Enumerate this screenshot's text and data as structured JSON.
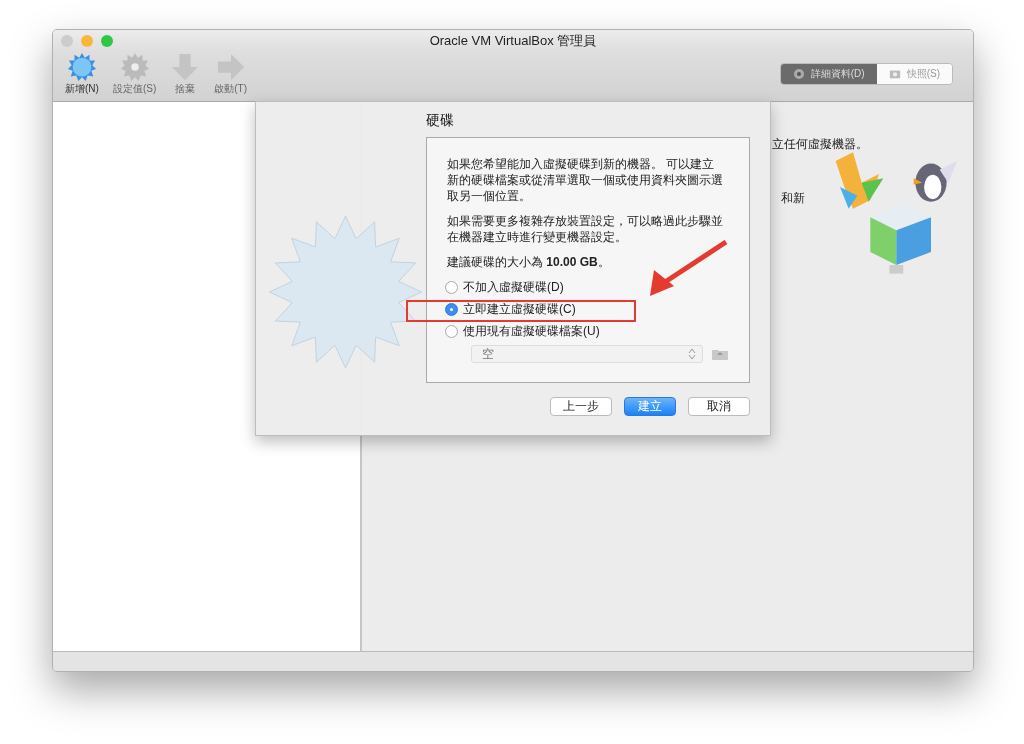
{
  "window": {
    "title": "Oracle VM VirtualBox 管理員"
  },
  "toolbar": [
    {
      "label": "新增(N)",
      "kind": "new",
      "disabled": false
    },
    {
      "label": "設定值(S)",
      "kind": "settings",
      "disabled": true
    },
    {
      "label": "捨棄",
      "kind": "discard",
      "disabled": true
    },
    {
      "label": "啟動(T)",
      "kind": "start",
      "disabled": true
    }
  ],
  "view_tabs": [
    {
      "label": "詳細資料(D)",
      "kind": "details",
      "selected": true
    },
    {
      "label": "快照(S)",
      "kind": "snapshots",
      "selected": false
    }
  ],
  "welcome": {
    "line_1_tail": "立任何虛擬機器。",
    "line_3_tail": "和新"
  },
  "dialog": {
    "title": "硬碟",
    "paragraphs": [
      "如果您希望能加入虛擬硬碟到新的機器。 可以建立新的硬碟檔案或從清單選取一個或使用資料夾圖示選取另一個位置。",
      "如果需要更多複雜存放裝置設定，可以略過此步驟並在機器建立時進行變更機器設定。",
      "建議硬碟的大小為 **10.00 GB**。"
    ],
    "options": [
      {
        "label": "不加入虛擬硬碟(D)",
        "selected": false
      },
      {
        "label": "立即建立虛擬硬碟(C)",
        "selected": true
      },
      {
        "label": "使用現有虛擬硬碟檔案(U)",
        "selected": false
      }
    ],
    "file_select": {
      "value": "空",
      "disabled": true
    },
    "buttons": [
      {
        "label": "上一步",
        "kind": "secondary"
      },
      {
        "label": "建立",
        "kind": "default"
      },
      {
        "label": "取消",
        "kind": "secondary"
      }
    ]
  }
}
